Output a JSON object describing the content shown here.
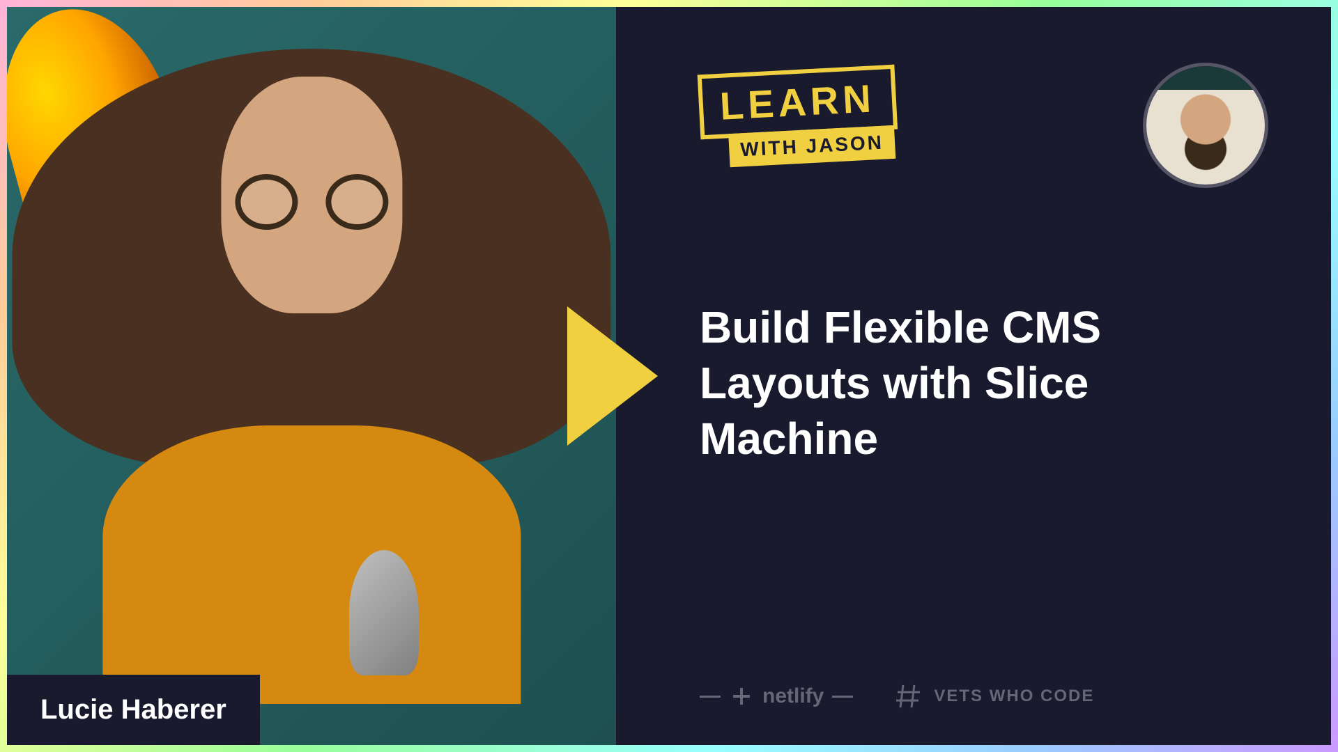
{
  "brand": {
    "learn": "LEARN",
    "with_jason": "WITH JASON"
  },
  "episode": {
    "title": "Build Flexible CMS Layouts with Slice Machine",
    "guest_name": "Lucie Haberer"
  },
  "sponsors": {
    "netlify": "netlify",
    "vets_who_code": "VETS WHO CODE"
  }
}
